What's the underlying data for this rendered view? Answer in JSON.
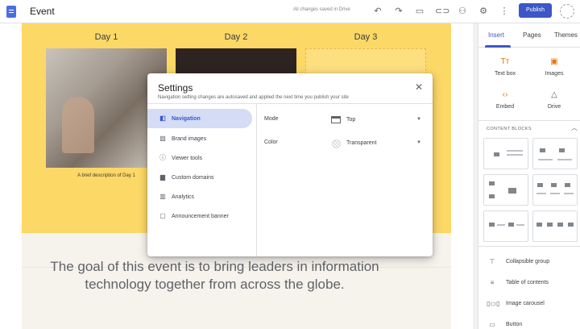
{
  "topbar": {
    "title": "Event",
    "save_status": "All changes saved in Drive",
    "publish_label": "Publish",
    "icons": [
      "undo-icon",
      "redo-icon",
      "preview-icon",
      "link-icon",
      "share-icon",
      "gear-icon",
      "more-vert-icon"
    ]
  },
  "canvas": {
    "days": [
      "Day 1",
      "Day 2",
      "Day 3"
    ],
    "caption_day1": "A brief description of Day 1",
    "goal_text": "The goal of this event is to bring leaders in information technology together from across the globe.",
    "hero_color": "#fcd867"
  },
  "side_panel": {
    "tabs": [
      "Insert",
      "Pages",
      "Themes"
    ],
    "active_tab": "Insert",
    "insert_items": [
      "Text box",
      "Images",
      "Embed",
      "Drive"
    ],
    "content_blocks_label": "CONTENT BLOCKS",
    "items": [
      "Collapsible group",
      "Table of contents",
      "Image carousel",
      "Button"
    ]
  },
  "settings_modal": {
    "title": "Settings",
    "subtitle": "Navigation setting changes are autosaved and applied the next time you publish your site",
    "nav": [
      "Navigation",
      "Brand images",
      "Viewer tools",
      "Custom domains",
      "Analytics",
      "Announcement banner"
    ],
    "active_nav": "Navigation",
    "mode_label": "Mode",
    "mode_value": "Top",
    "color_label": "Color",
    "color_value": "Transparent"
  },
  "colors": {
    "accent": "#3d57c9",
    "active_nav_bg": "#d4dcf6"
  }
}
